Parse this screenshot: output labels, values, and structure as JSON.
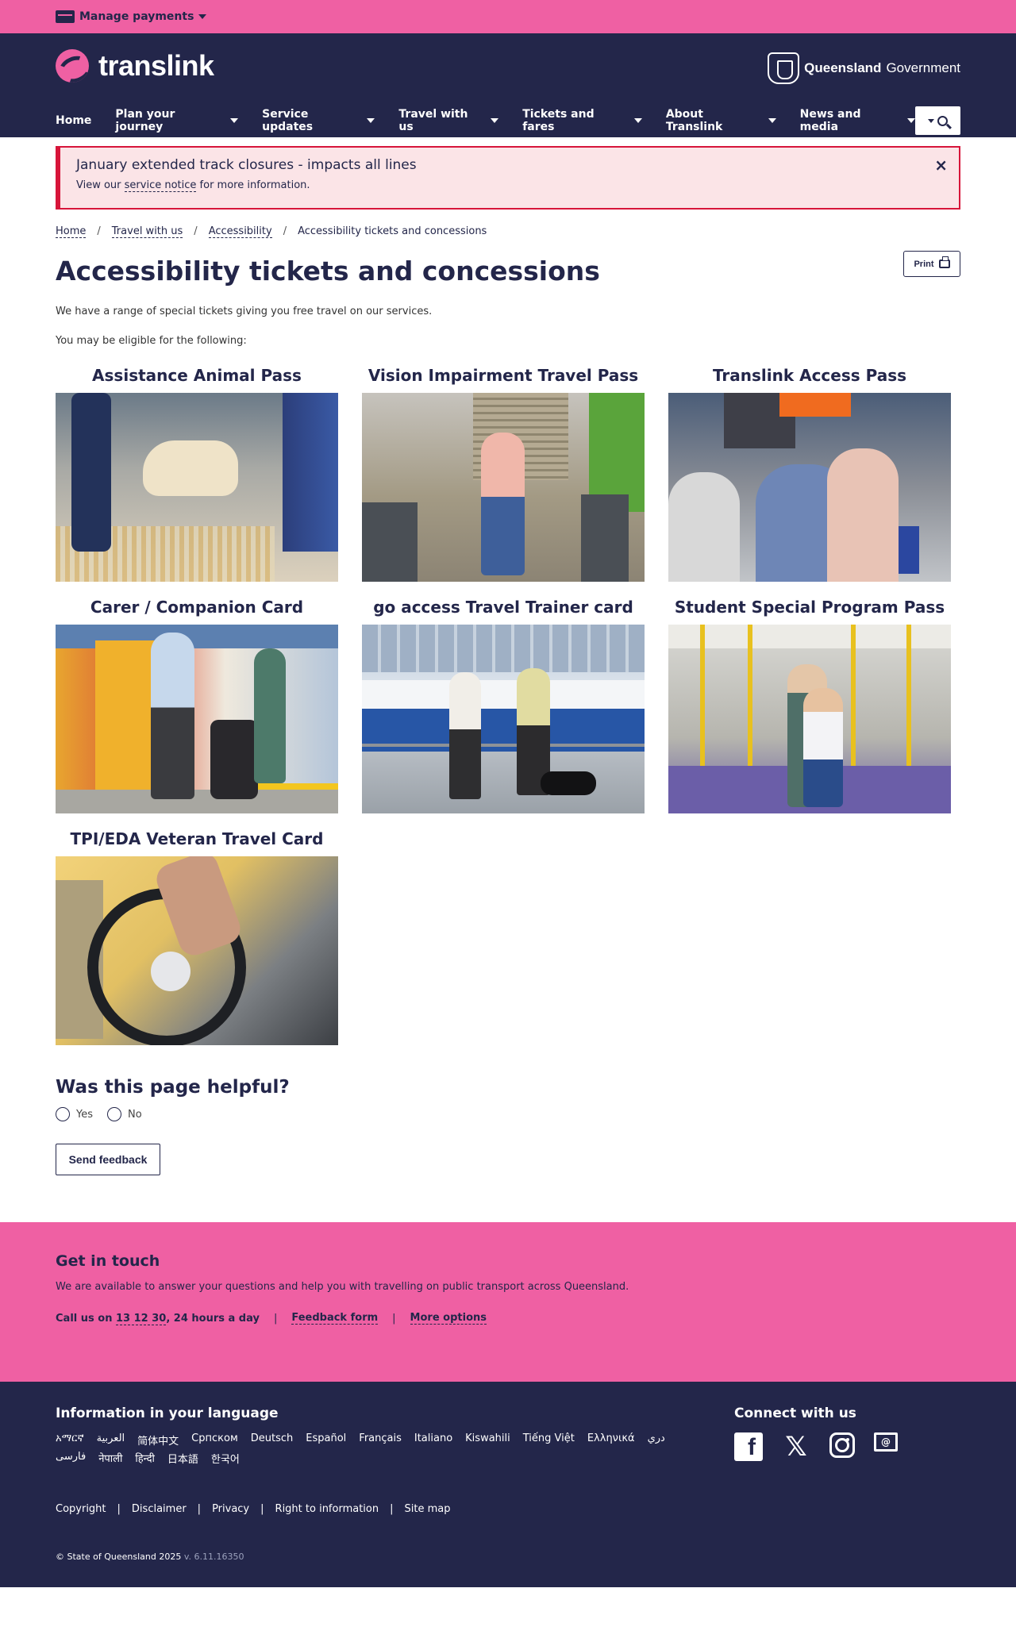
{
  "utility": {
    "manage_payments": "Manage payments"
  },
  "header": {
    "brand": "translink",
    "gov_bold": "Queensland",
    "gov_light": "Government",
    "nav": [
      {
        "label": "Home",
        "has_menu": false
      },
      {
        "label": "Plan your journey",
        "has_menu": true
      },
      {
        "label": "Service updates",
        "has_menu": true
      },
      {
        "label": "Travel with us",
        "has_menu": true
      },
      {
        "label": "Tickets and fares",
        "has_menu": true
      },
      {
        "label": "About Translink",
        "has_menu": true
      },
      {
        "label": "News and media",
        "has_menu": true
      }
    ]
  },
  "alert": {
    "title": "January extended track closures - impacts all lines",
    "body_prefix": "View our ",
    "link": "service notice",
    "body_suffix": " for more information.",
    "close": "×"
  },
  "breadcrumb": {
    "items": [
      "Home",
      "Travel with us",
      "Accessibility"
    ],
    "current": "Accessibility tickets and concessions",
    "separator": "/"
  },
  "page": {
    "title": "Accessibility tickets and concessions",
    "print": "Print",
    "intro1": "We have a range of special tickets giving you free travel on our services.",
    "intro2": "You may be eligible for the following:"
  },
  "cards": [
    {
      "title": "Assistance Animal Pass"
    },
    {
      "title": "Vision Impairment Travel Pass"
    },
    {
      "title": "Translink Access Pass"
    },
    {
      "title": "Carer / Companion Card"
    },
    {
      "title": "go access Travel Trainer card"
    },
    {
      "title": "Student Special Program Pass"
    },
    {
      "title": "TPI/EDA Veteran Travel Card"
    }
  ],
  "feedback": {
    "title": "Was this page helpful?",
    "yes": "Yes",
    "no": "No",
    "send": "Send feedback"
  },
  "touch": {
    "title": "Get in touch",
    "text": "We are available to answer your questions and help you with travelling on public transport across Queensland.",
    "call_prefix": "Call us on ",
    "phone": "13 12 30",
    "call_suffix": ", 24 hours a day",
    "feedback_form": "Feedback form",
    "more_options": "More options",
    "sep": "|"
  },
  "footer": {
    "lang_title": "Information in your language",
    "languages": [
      "አማርኛ",
      "العربية",
      "简体中文",
      "Српском",
      "Deutsch",
      "Español",
      "Français",
      "Italiano",
      "Kiswahili",
      "Tiếng Việt",
      "Ελληνικά",
      "دري",
      "فارسی",
      "नेपाली",
      "हिन्दी",
      "日本語",
      "한국어"
    ],
    "connect_title": "Connect with us",
    "links": [
      "Copyright",
      "Disclaimer",
      "Privacy",
      "Right to information",
      "Site map"
    ],
    "copyright": "© State of Queensland 2025",
    "version": "v. 6.11.16350"
  },
  "colors": {
    "pink": "#ef60a3",
    "navy": "#23264a",
    "alert_red": "#d7153a"
  }
}
